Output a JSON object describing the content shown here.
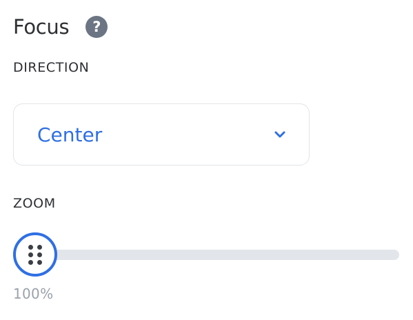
{
  "panel": {
    "title": "Focus",
    "help_icon": "question-circle-icon",
    "help_glyph": "?"
  },
  "direction": {
    "label": "DIRECTION",
    "selected": "Center",
    "icon": "chevron-down-icon"
  },
  "zoom": {
    "label": "ZOOM",
    "value_text": "100%",
    "slider_fraction": 0,
    "handle_icon": "drag-grip-icon"
  },
  "colors": {
    "accent": "#2f6fe4",
    "text": "#2d2f33",
    "muted": "#9aa1ab",
    "help_icon_bg": "#6b7583",
    "track": "#e2e5ea",
    "border": "#e1e4e8"
  }
}
